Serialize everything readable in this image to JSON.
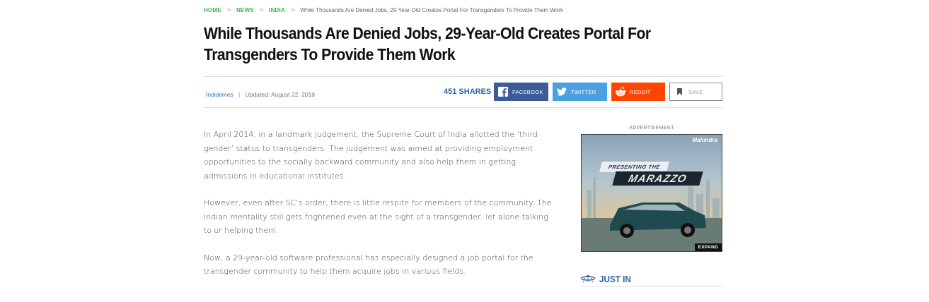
{
  "breadcrumb": {
    "items": [
      "HOME",
      "NEWS",
      "INDIA"
    ],
    "separator": ">",
    "current": "While Thousands Are Denied Jobs, 29-Year-Old Creates Portal For Transgenders To Provide Them Work"
  },
  "article": {
    "title_line1": "While Thousands Are Denied Jobs, 29-Year-Old Creates Portal For",
    "title_line2": "Transgenders To Provide Them Work",
    "author": "Indiatimes",
    "separator": "|",
    "updated": "Updated: August 22, 2018",
    "paragraphs": [
      "In April 2014, in a landmark judgement, the Supreme Court of India allotted the ‘third gender’ status to transgenders. The judgement was aimed at providing employment opportunities to the socially backward community and also help them in getting admissions in educational institutes.",
      "However, even after SC’s order, there is little respite for members of the community. The Indian mentality still gets frightened even at the sight of a transgender, let alone talking to or helping them.",
      "Now, a 29-year-old software professional has especially designed a job portal for the transgender community to help them acquire jobs in various fields."
    ]
  },
  "share": {
    "count": "451 SHARES",
    "facebook": "FACEBOOK",
    "twitter": "TWITTER",
    "reddit": "REDDIT",
    "save": "SAVE"
  },
  "ad": {
    "label": "ADVERTISEMENT",
    "brand": "Mahindra",
    "presenting": "PRESENTING THE",
    "model": "MARAZZO",
    "expand": "EXPAND"
  },
  "sidebar": {
    "just_in": "JUST IN"
  },
  "colors": {
    "breadcrumb_link": "#3ab54a",
    "share_count": "#2f64a8",
    "facebook": "#3d5b96",
    "twitter": "#4aa0e0",
    "reddit": "#ff4500",
    "just_in": "#2f64a8"
  },
  "icons": {
    "facebook": "facebook-icon",
    "twitter": "twitter-icon",
    "reddit": "reddit-icon",
    "save": "bookmark-icon",
    "just_in": "ufo-icon"
  }
}
